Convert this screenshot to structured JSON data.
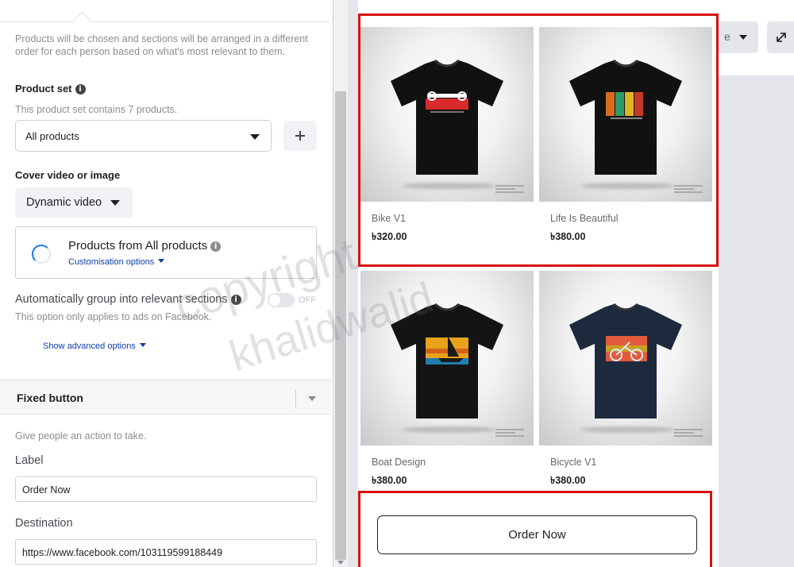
{
  "left_panel": {
    "top_description": "Products will be chosen and sections will be arranged in a different order for each person based on what's most relevant to them.",
    "product_set": {
      "heading": "Product set",
      "info_glyph": "i",
      "note": "This product set contains 7 products.",
      "selected": "All products"
    },
    "cover": {
      "heading": "Cover video or image",
      "button_label": "Dynamic video",
      "products_title": "Products from All products",
      "customisation_link": "Customisation options"
    },
    "grouping": {
      "label": "Automatically group into relevant sections",
      "toggle_state": "OFF",
      "note": "This option only applies to ads on Facebook.",
      "advanced_link": "Show advanced options"
    },
    "fixed_button": {
      "heading": "Fixed button",
      "description": "Give people an action to take.",
      "label_caption": "Label",
      "label_value": "Order Now",
      "destination_caption": "Destination",
      "destination_value": "https://www.facebook.com/103119599188449"
    }
  },
  "preview": {
    "products": [
      {
        "name": "Bike V1",
        "price": "৳320.00",
        "shirt_color": "#111111",
        "design": "bike-v1"
      },
      {
        "name": "Life Is Beautiful",
        "price": "৳380.00",
        "shirt_color": "#111111",
        "design": "life-is-beautiful"
      },
      {
        "name": "Boat Design",
        "price": "৳380.00",
        "shirt_color": "#141414",
        "design": "boat"
      },
      {
        "name": "Bicycle V1",
        "price": "৳380.00",
        "shirt_color": "#1d2a3d",
        "design": "bicycle"
      }
    ],
    "order_button_label": "Order Now",
    "highlight_color": "#d90f0f"
  },
  "right_strip": {
    "dropdown_text_fragment": "e"
  },
  "watermark": {
    "line1": "copyright",
    "line2": "khalidwalid"
  }
}
